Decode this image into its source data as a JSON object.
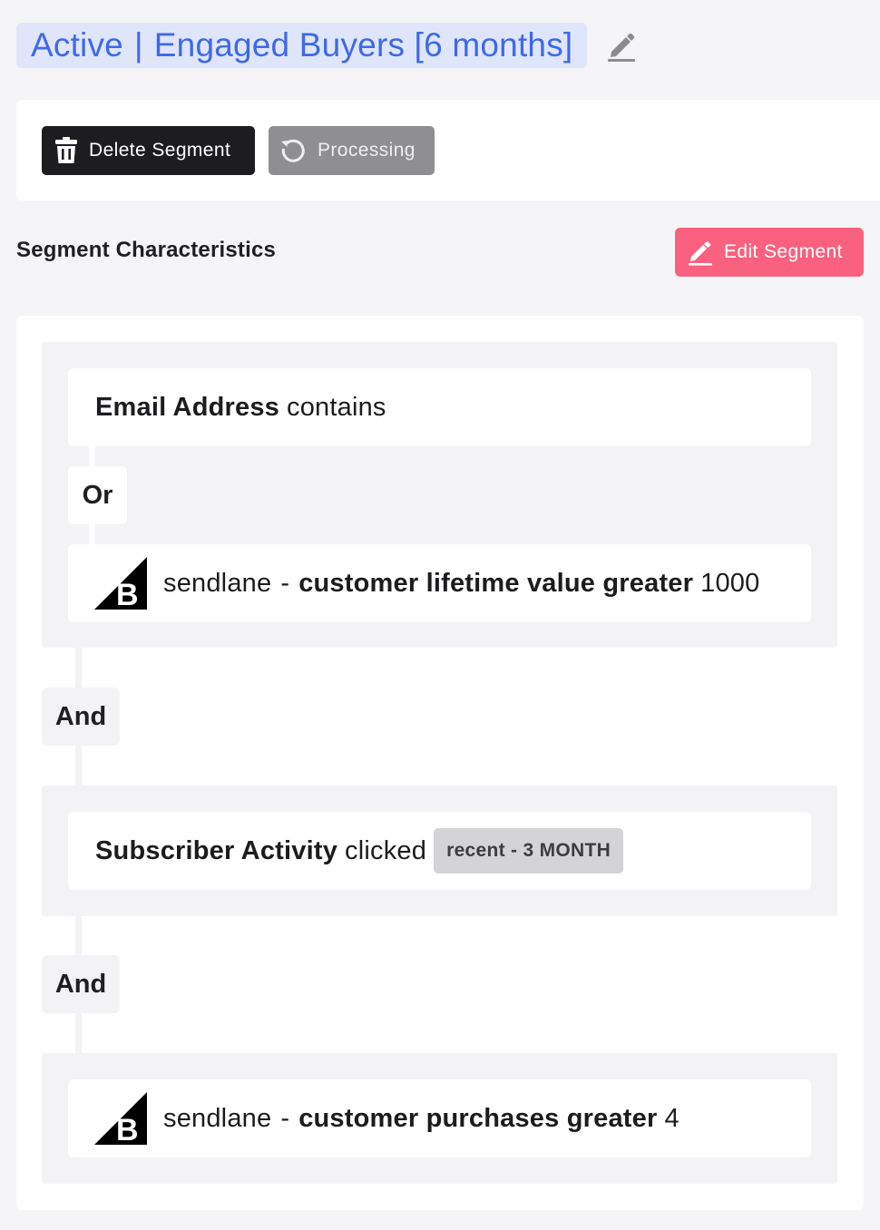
{
  "header": {
    "status": "Active",
    "separator": "|",
    "segment_name": "Engaged Buyers [6 months]",
    "edit_icon": "pencil-icon"
  },
  "actions": {
    "delete_label": "Delete Segment",
    "delete_icon": "trash-icon",
    "processing_label": "Processing",
    "processing_icon": "refresh-icon"
  },
  "characteristics": {
    "title": "Segment Characteristics",
    "edit_label": "Edit Segment",
    "edit_icon": "pencil-icon"
  },
  "conditions": {
    "group1": {
      "rule1": {
        "field": "Email Address",
        "operator": "contains"
      },
      "joiner": "Or",
      "rule2": {
        "source": "sendlane",
        "dash": "-",
        "condition": "customer lifetime value greater",
        "value": "1000",
        "icon": "bigcommerce-logo"
      }
    },
    "joiner1": "And",
    "group2": {
      "rule1": {
        "field": "Subscriber Activity",
        "operator": "clicked",
        "badge": "recent - 3 MONTH"
      }
    },
    "joiner2": "And",
    "group3": {
      "rule1": {
        "source": "sendlane",
        "dash": "-",
        "condition": "customer purchases greater",
        "value": "4",
        "icon": "bigcommerce-logo"
      }
    }
  },
  "colors": {
    "accent_blue": "#3f69e8",
    "edit_pink": "#f9617e",
    "delete_black": "#1d1d20",
    "processing_gray": "#8f8f93"
  }
}
